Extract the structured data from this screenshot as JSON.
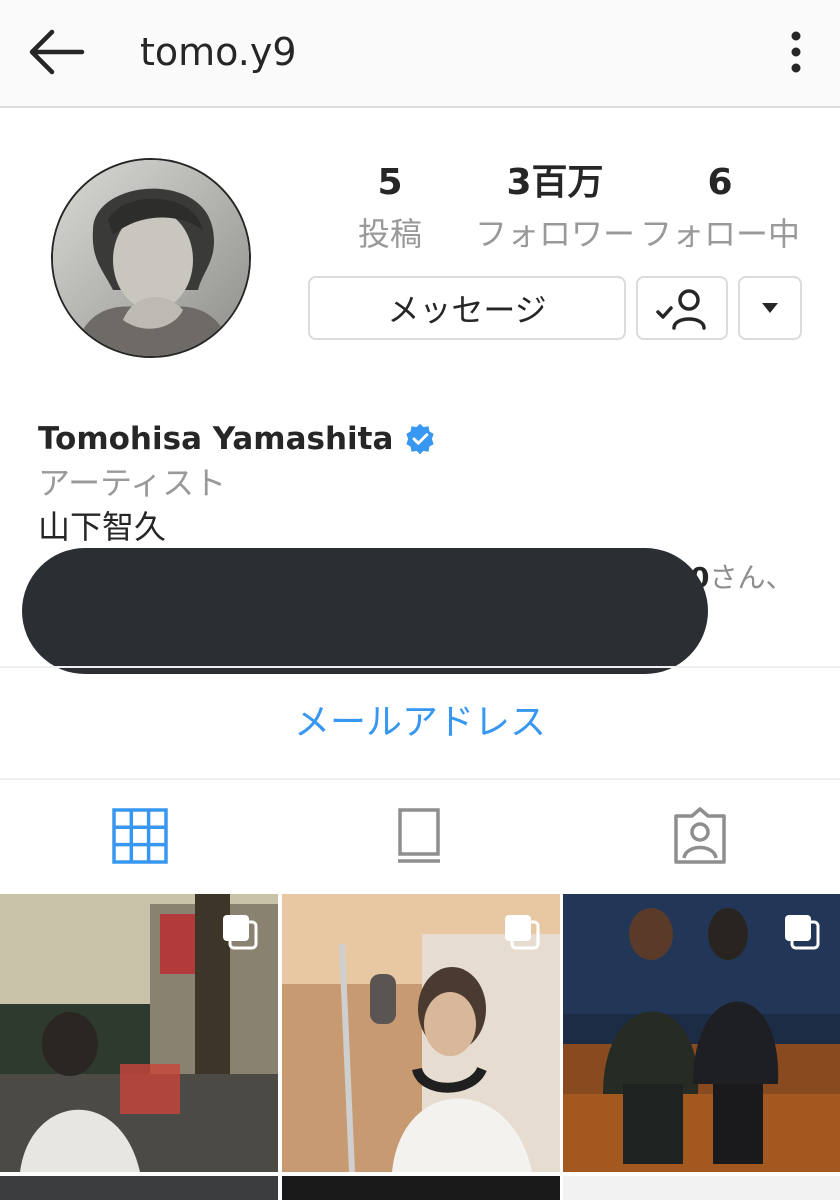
{
  "header": {
    "username": "tomo.y9",
    "back_icon": "arrow-left-icon",
    "more_icon": "more-vertical-icon"
  },
  "profile": {
    "stats": {
      "posts_count": "5",
      "posts_label": "投稿",
      "followers_count": "3百万",
      "followers_label": "フォロワー",
      "following_count": "6",
      "following_label": "フォロー中"
    },
    "buttons": {
      "message_label": "メッセージ",
      "following_icon": "person-check-icon",
      "dropdown_icon": "caret-down-icon"
    },
    "full_name": "Tomohisa Yamashita",
    "verified_icon": "verified-badge-icon",
    "category": "アーティスト",
    "bio": "山下智久",
    "followed_by_visible_tail": "0",
    "followed_by_suffix": "さん、"
  },
  "contact": {
    "email_label": "メールアドレス"
  },
  "tabs": {
    "grid_icon": "grid-icon",
    "feed_icon": "feed-icon",
    "tagged_icon": "tagged-person-icon"
  },
  "colors": {
    "link_blue": "#3897f0",
    "verified_blue": "#3897f0",
    "text_primary": "#262626",
    "text_secondary": "#999999",
    "border": "#dbdbdb",
    "redaction": "#2b2e33"
  }
}
